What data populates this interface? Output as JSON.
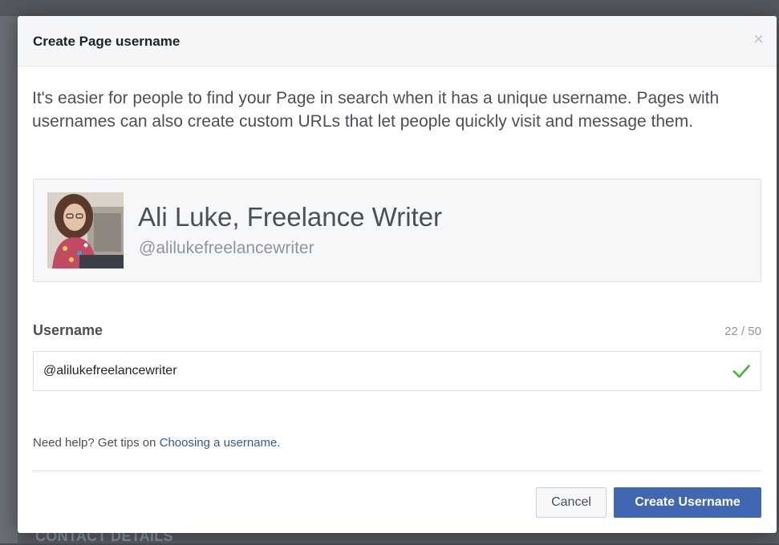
{
  "dialog": {
    "title": "Create Page username",
    "close_label": "×",
    "intro": "It's easier for people to find your Page in search when it has a unique username. Pages with usernames can also create custom URLs that let people quickly visit and message them."
  },
  "page_card": {
    "name": "Ali Luke, Freelance Writer",
    "handle": "@alilukefreelancewriter"
  },
  "username_field": {
    "label": "Username",
    "counter": "22 / 50",
    "value": "@alilukefreelancewriter",
    "status_icon": "check-icon",
    "status_color": "#42b72a"
  },
  "help": {
    "prefix": "Need help? Get tips on ",
    "link_text": "Choosing a username",
    "suffix": "."
  },
  "buttons": {
    "cancel": "Cancel",
    "create": "Create Username"
  },
  "background": {
    "section_heading": "CONTACT DETAILS"
  },
  "colors": {
    "primary": "#4267b2",
    "link": "#365899"
  }
}
